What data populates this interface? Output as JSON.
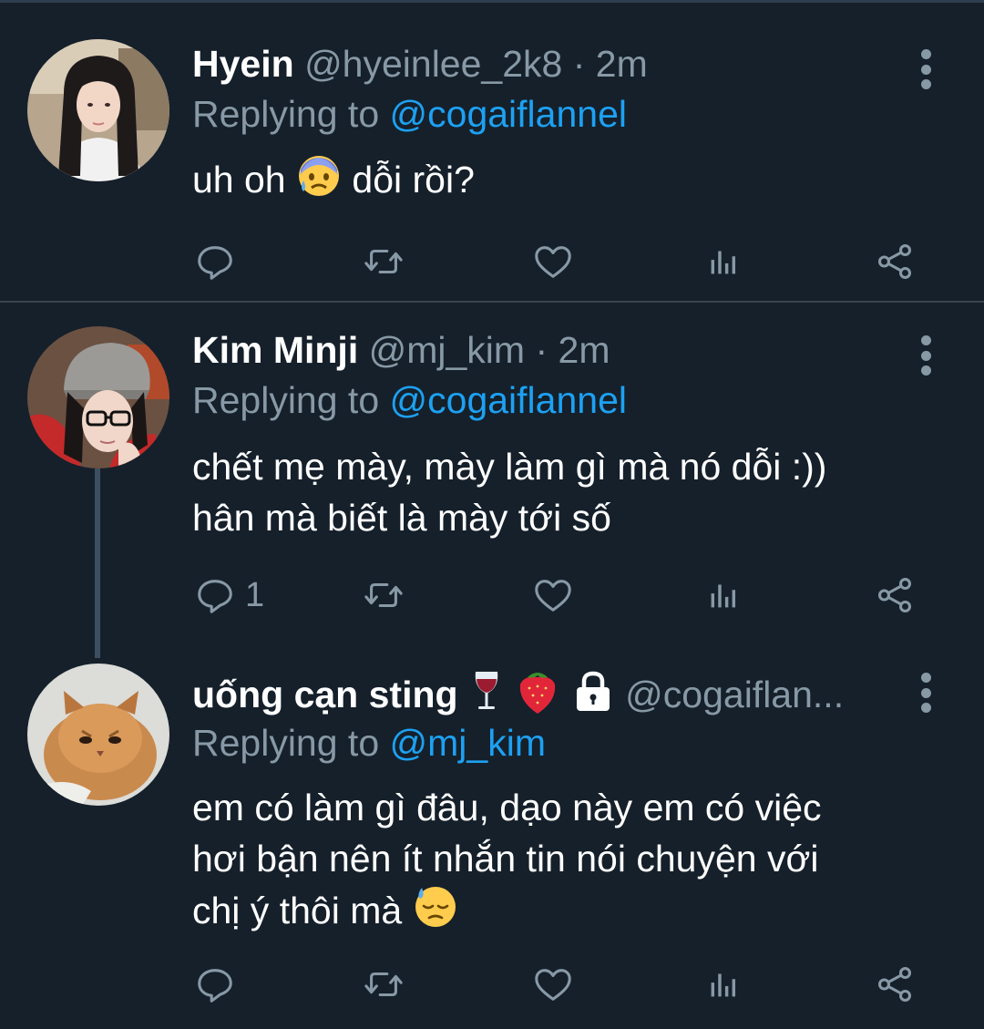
{
  "colors": {
    "background": "#15202b",
    "secondary_text": "#8899a6",
    "link": "#1da1f2",
    "divider": "#38444d"
  },
  "tweets": [
    {
      "name": "Hyein",
      "handle": "@hyeinlee_2k8",
      "separator": "·",
      "time": "2m",
      "replying_prefix": "Replying to",
      "replying_to": "@cogaiflannel",
      "text_lines": [
        "uh oh",
        "dỗi rồi?"
      ],
      "emoji_icons": [
        "anxious-sweat-face-icon"
      ],
      "reply_count": "",
      "icons": [
        "reply-icon",
        "retweet-icon",
        "like-icon",
        "analytics-icon",
        "share-icon"
      ]
    },
    {
      "name": "Kim Minji",
      "handle": "@mj_kim",
      "separator": "·",
      "time": "2m",
      "replying_prefix": "Replying to",
      "replying_to": "@cogaiflannel",
      "text_lines": [
        "chết mẹ mày, mày làm gì mà nó dỗi :))",
        "hân mà biết là mày tới số"
      ],
      "reply_count": "1",
      "icons": [
        "reply-icon",
        "retweet-icon",
        "like-icon",
        "analytics-icon",
        "share-icon"
      ]
    },
    {
      "name": "uống cạn sting",
      "name_icons": [
        "wine-glass-icon",
        "strawberry-icon",
        "lock-icon"
      ],
      "handle": "@cogaiflan...",
      "replying_prefix": "Replying to",
      "replying_to": "@mj_kim",
      "text_lines": [
        "em có làm gì đâu, dạo này em có việc",
        "hơi bận nên ít nhắn tin nói chuyện với",
        "chị ý thôi mà"
      ],
      "emoji_icons": [
        "downcast-sweat-face-icon"
      ],
      "reply_count": "",
      "icons": [
        "reply-icon",
        "retweet-icon",
        "like-icon",
        "analytics-icon",
        "share-icon"
      ]
    }
  ]
}
